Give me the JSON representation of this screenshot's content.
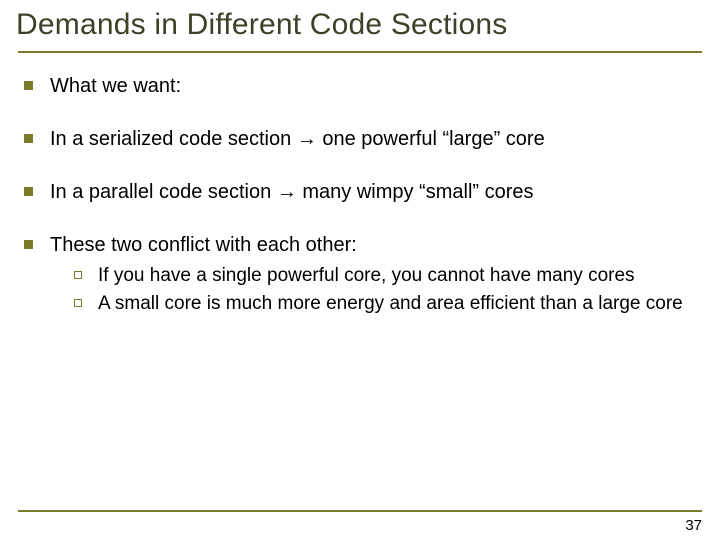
{
  "title": "Demands in Different Code Sections",
  "bullets": {
    "b0": "What we want:",
    "b1_a": "In a serialized code section ",
    "b1_b": " one powerful “large” core",
    "b2_a": "In a parallel code section ",
    "b2_b": " many wimpy “small” cores",
    "b3": "These two conflict with each other:"
  },
  "sub": {
    "s0": "If you have a single powerful core, you cannot have many cores",
    "s1": "A small core is much more energy and area efficient than a large core"
  },
  "arrow": "→",
  "page": "37"
}
